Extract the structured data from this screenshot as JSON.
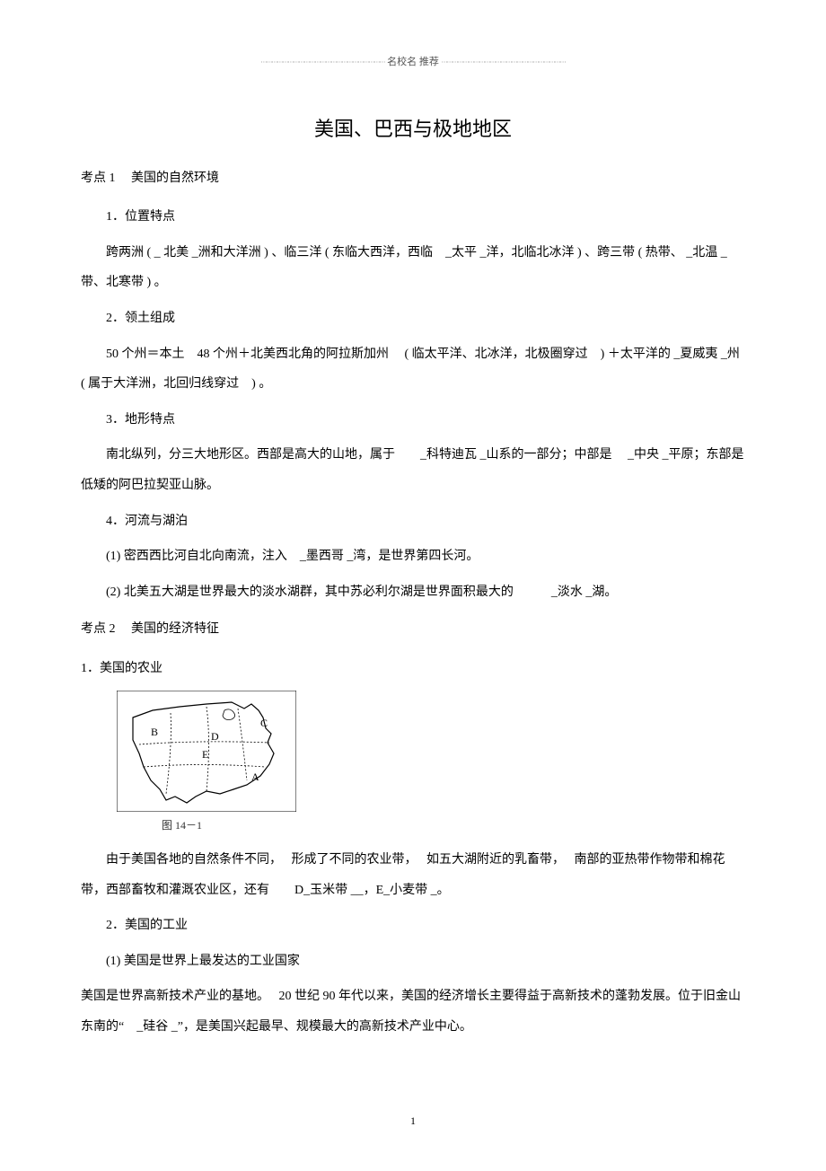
{
  "header": {
    "label": "名校名  推荐"
  },
  "title": "美国、巴西与极地地区",
  "kp1": {
    "heading": "考点 1　 美国的自然环境",
    "s1": {
      "label": "1．位置特点",
      "body": "跨两洲 ( _ 北美 _洲和大洋洲  ) 、临三洋 ( 东临大西洋，西临　_太平 _洋，北临北冰洋  ) 、跨三带 ( 热带、 _北温 _带、北寒带 ) 。"
    },
    "s2": {
      "label": "2．领土组成",
      "body": "50 个州＝本土　48 个州＋北美西北角的阿拉斯加州　 ( 临太平洋、北冰洋，北极圈穿过　) ＋太平洋的  _夏威夷 _州 ( 属于大洋洲，北回归线穿过　) 。"
    },
    "s3": {
      "label": "3．地形特点",
      "body": "南北纵列，分三大地形区。西部是高大的山地，属于　　_科特迪瓦 _山系的一部分；中部是　 _中央 _平原；东部是低矮的阿巴拉契亚山脉。"
    },
    "s4": {
      "label": "4．河流与湖泊",
      "p1": "(1) 密西西比河自北向南流，注入　_墨西哥 _湾，是世界第四长河。",
      "p2": "(2) 北美五大湖是世界最大的淡水湖群，其中苏必利尔湖是世界面积最大的　　　_淡水 _湖。"
    }
  },
  "kp2": {
    "heading": "考点 2　 美国的经济特征",
    "s1": {
      "label": "1．美国的农业",
      "figcaption": "图 14－1",
      "body": "由于美国各地的自然条件不同，　 形成了不同的农业带，　 如五大湖附近的乳畜带，　 南部的亚热带作物带和棉花带，西部畜牧和灌溉农业区，还有　　D_玉米带 __，E_小麦带 _。"
    },
    "s2": {
      "label": "2．美国的工业",
      "p1": "(1) 美国是世界上最发达的工业国家",
      "body": "美国是世界高新技术产业的基地。　 20 世纪 90 年代以来，美国的经济增长主要得益于高新技术的蓬勃发展。位于旧金山东南的“　_硅谷 _”，是美国兴起最早、规模最大的高新技术产业中心。"
    }
  },
  "map_labels": {
    "a": "A",
    "b": "B",
    "c": "C",
    "d": "D",
    "e": "E"
  },
  "pagenum": "1"
}
